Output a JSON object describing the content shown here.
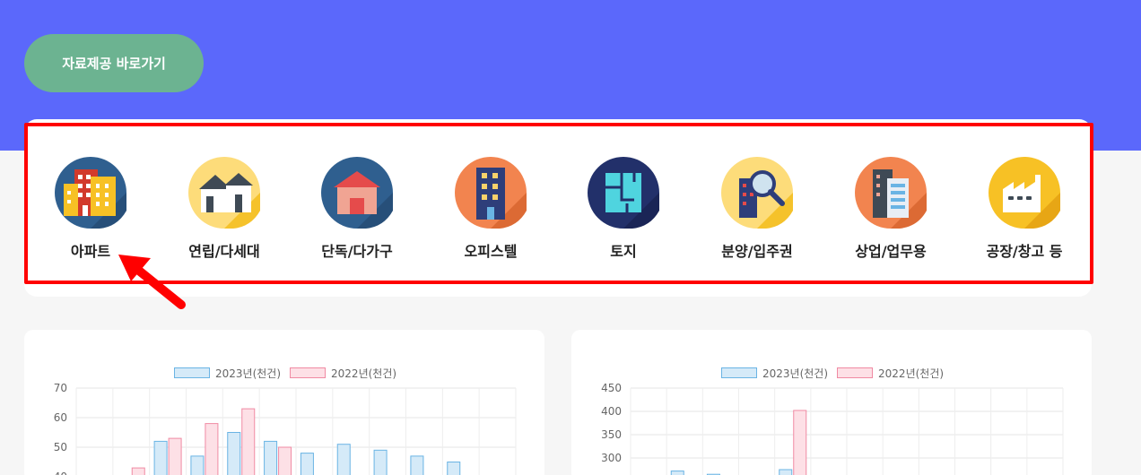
{
  "cta": {
    "label": "자료제공 바로가기"
  },
  "categories": [
    {
      "label": "아파트",
      "icon": "apartment-icon"
    },
    {
      "label": "연립/다세대",
      "icon": "row-house-icon"
    },
    {
      "label": "단독/다가구",
      "icon": "detached-house-icon"
    },
    {
      "label": "오피스텔",
      "icon": "officetel-icon"
    },
    {
      "label": "토지",
      "icon": "land-icon"
    },
    {
      "label": "분양/입주권",
      "icon": "presale-search-icon"
    },
    {
      "label": "상업/업무용",
      "icon": "commercial-building-icon"
    },
    {
      "label": "공장/창고 등",
      "icon": "factory-icon"
    }
  ],
  "colors": {
    "hero": "#5b68fb",
    "cta": "#6cb391",
    "highlight": "#ff0000",
    "series_2023_fill": "#d5eaf8",
    "series_2023_stroke": "#6ab4e4",
    "series_2022_fill": "#fde0e6",
    "series_2022_stroke": "#f08aa3"
  },
  "chart_data": [
    {
      "type": "bar",
      "series": [
        {
          "name": "2023년(천건)",
          "values": [
            null,
            null,
            52,
            47,
            55,
            52,
            48,
            51,
            49,
            47,
            45,
            null
          ]
        },
        {
          "name": "2022년(천건)",
          "values": [
            null,
            43,
            53,
            58,
            63,
            50,
            null,
            null,
            null,
            null,
            null,
            null
          ]
        }
      ],
      "ylim": [
        40,
        70
      ],
      "yticks": [
        70,
        60,
        50,
        40
      ],
      "grid": true,
      "legend": "top"
    },
    {
      "type": "bar",
      "series": [
        {
          "name": "2023년(천건)",
          "values": [
            null,
            272,
            265,
            null,
            275,
            null,
            null,
            null,
            null,
            null,
            null,
            null
          ]
        },
        {
          "name": "2022년(천건)",
          "values": [
            null,
            null,
            null,
            null,
            402,
            null,
            null,
            null,
            null,
            null,
            null,
            null
          ]
        }
      ],
      "ylim": [
        260,
        450
      ],
      "yticks": [
        450,
        400,
        350,
        300
      ],
      "grid": true,
      "legend": "top"
    }
  ]
}
